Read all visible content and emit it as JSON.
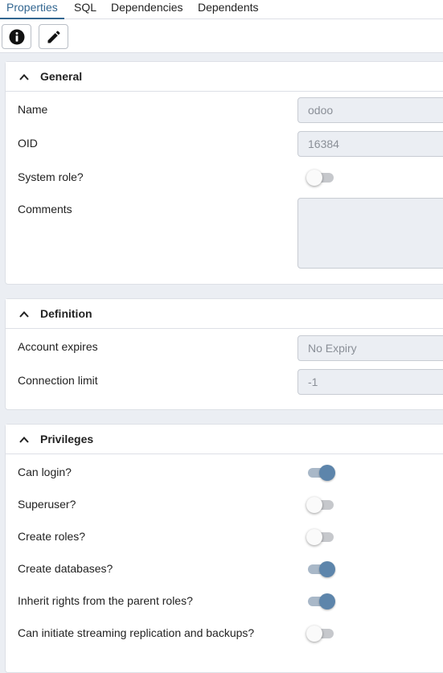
{
  "tabs": [
    {
      "label": "Properties",
      "active": true
    },
    {
      "label": "SQL",
      "active": false
    },
    {
      "label": "Dependencies",
      "active": false
    },
    {
      "label": "Dependents",
      "active": false
    }
  ],
  "toolbar": {
    "info_icon": "info-circle-icon",
    "edit_icon": "pencil-icon"
  },
  "general": {
    "title": "General",
    "name_label": "Name",
    "name_value": "odoo",
    "oid_label": "OID",
    "oid_value": "16384",
    "system_role_label": "System role?",
    "system_role": false,
    "comments_label": "Comments",
    "comments_value": ""
  },
  "definition": {
    "title": "Definition",
    "account_expires_label": "Account expires",
    "account_expires_value": "No Expiry",
    "connection_limit_label": "Connection limit",
    "connection_limit_value": "-1"
  },
  "privileges": {
    "title": "Privileges",
    "can_login_label": "Can login?",
    "can_login": true,
    "superuser_label": "Superuser?",
    "superuser": false,
    "create_roles_label": "Create roles?",
    "create_roles": false,
    "create_databases_label": "Create databases?",
    "create_databases": true,
    "inherit_label": "Inherit rights from the parent roles?",
    "inherit": true,
    "replication_label": "Can initiate streaming replication and backups?",
    "replication": false
  },
  "colors": {
    "accent": "#326690",
    "toggle_on": "#5d85ab",
    "toggle_off": "#c6c8cc"
  }
}
